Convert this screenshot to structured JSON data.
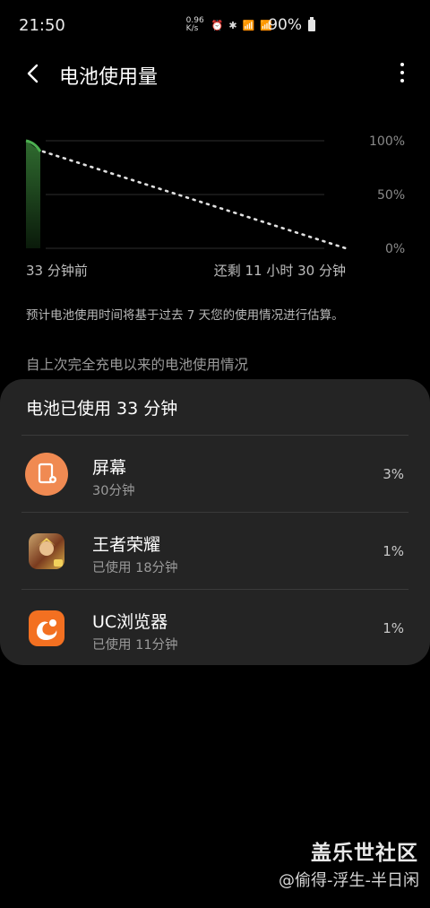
{
  "status_bar": {
    "time": "21:50",
    "net_speed": "0.96 K/s",
    "icons": [
      "alarm-icon",
      "bluetooth-icon",
      "4g-signal-icon",
      "2g-signal-icon"
    ],
    "battery_percent": "90%"
  },
  "app_bar": {
    "title": "电池使用量",
    "back_icon": "back-arrow-icon",
    "more_icon": "more-vertical-icon"
  },
  "chart_data": {
    "type": "line",
    "y_ticks": [
      "100%",
      "50%",
      "0%"
    ],
    "ylim": [
      0,
      100
    ],
    "x_labels": [
      "33 分钟前",
      "还剩 11 小时 30 分钟"
    ],
    "series": [
      {
        "values": [
          100,
          90
        ],
        "style": "solid",
        "color": "#4caf50"
      },
      {
        "values": [
          90,
          0
        ],
        "style": "dotted",
        "color": "#e0e0e0"
      }
    ],
    "grid": true
  },
  "note": "预计电池使用时间将基于过去 7 天您的使用情况进行估算。",
  "section_header": "自上次完全充电以来的电池使用情况",
  "card": {
    "title": "电池已使用 33 分钟",
    "apps": [
      {
        "name": "屏幕",
        "sub": "30分钟",
        "percent": "3%",
        "icon": "screen-settings-icon",
        "color": "#f08a52"
      },
      {
        "name": "王者荣耀",
        "sub": "已使用 18分钟",
        "percent": "1%",
        "icon": "honor-of-kings-icon",
        "color": "#7a3b1f"
      },
      {
        "name": "UC浏览器",
        "sub": "已使用 11分钟",
        "percent": "1%",
        "icon": "uc-browser-icon",
        "color": "#f37021"
      }
    ]
  },
  "watermark": {
    "line1": "盖乐世社区",
    "line2": "@偷得-浮生-半日闲"
  },
  "colors": {
    "background": "#000000",
    "card": "#242424",
    "accent_green": "#4caf50"
  }
}
